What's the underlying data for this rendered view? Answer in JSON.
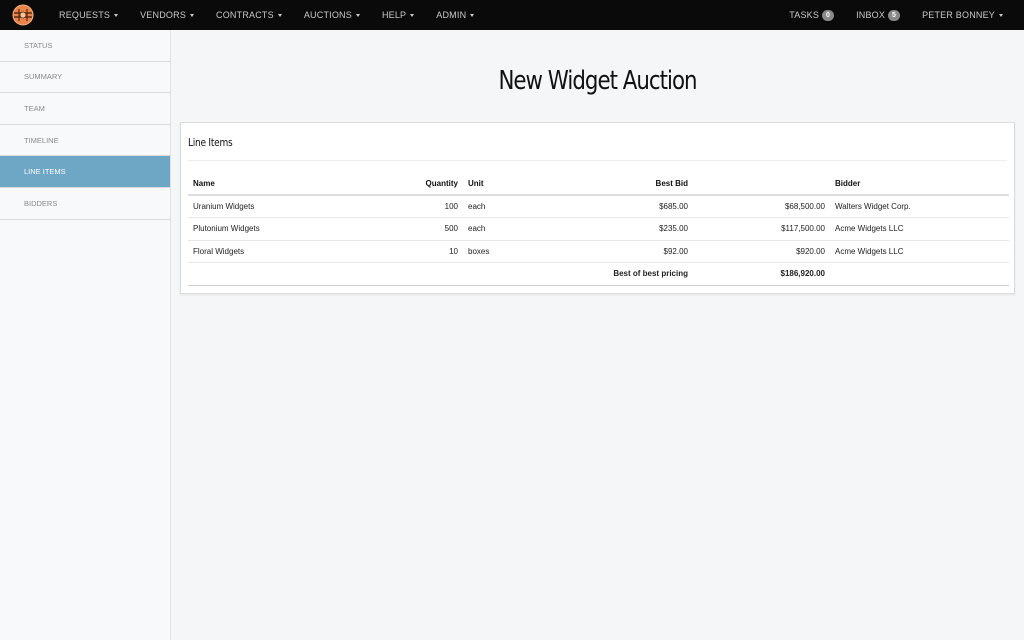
{
  "nav": {
    "items": [
      {
        "label": "Requests"
      },
      {
        "label": "Vendors"
      },
      {
        "label": "Contracts"
      },
      {
        "label": "Auctions"
      },
      {
        "label": "Help"
      },
      {
        "label": "Admin"
      }
    ],
    "tasks_label": "Tasks",
    "tasks_count": "0",
    "inbox_label": "Inbox",
    "inbox_count": "5",
    "user_label": "Peter Bonney"
  },
  "sidebar": {
    "items": [
      {
        "label": "Status"
      },
      {
        "label": "Summary"
      },
      {
        "label": "Team"
      },
      {
        "label": "Timeline"
      },
      {
        "label": "Line Items"
      },
      {
        "label": "Bidders"
      }
    ],
    "active_index": 4
  },
  "page": {
    "title": "New Widget Auction"
  },
  "panel": {
    "title": "Line Items",
    "columns": {
      "name": "Name",
      "quantity": "Quantity",
      "unit": "Unit",
      "best_bid": "Best Bid",
      "total": "",
      "bidder": "Bidder"
    },
    "rows": [
      {
        "name": "Uranium Widgets",
        "quantity": "100",
        "unit": "each",
        "best_bid": "$685.00",
        "total": "$68,500.00",
        "bidder": "Walters Widget Corp."
      },
      {
        "name": "Plutonium Widgets",
        "quantity": "500",
        "unit": "each",
        "best_bid": "$235.00",
        "total": "$117,500.00",
        "bidder": "Acme Widgets LLC"
      },
      {
        "name": "Floral Widgets",
        "quantity": "10",
        "unit": "boxes",
        "best_bid": "$92.00",
        "total": "$920.00",
        "bidder": "Acme Widgets LLC"
      }
    ],
    "footer": {
      "label": "Best of best pricing",
      "total": "$186,920.00"
    }
  },
  "colors": {
    "navbar": "#0a0a0a",
    "sidebar_active": "#6ea7c6",
    "logo": "#e8834a"
  }
}
